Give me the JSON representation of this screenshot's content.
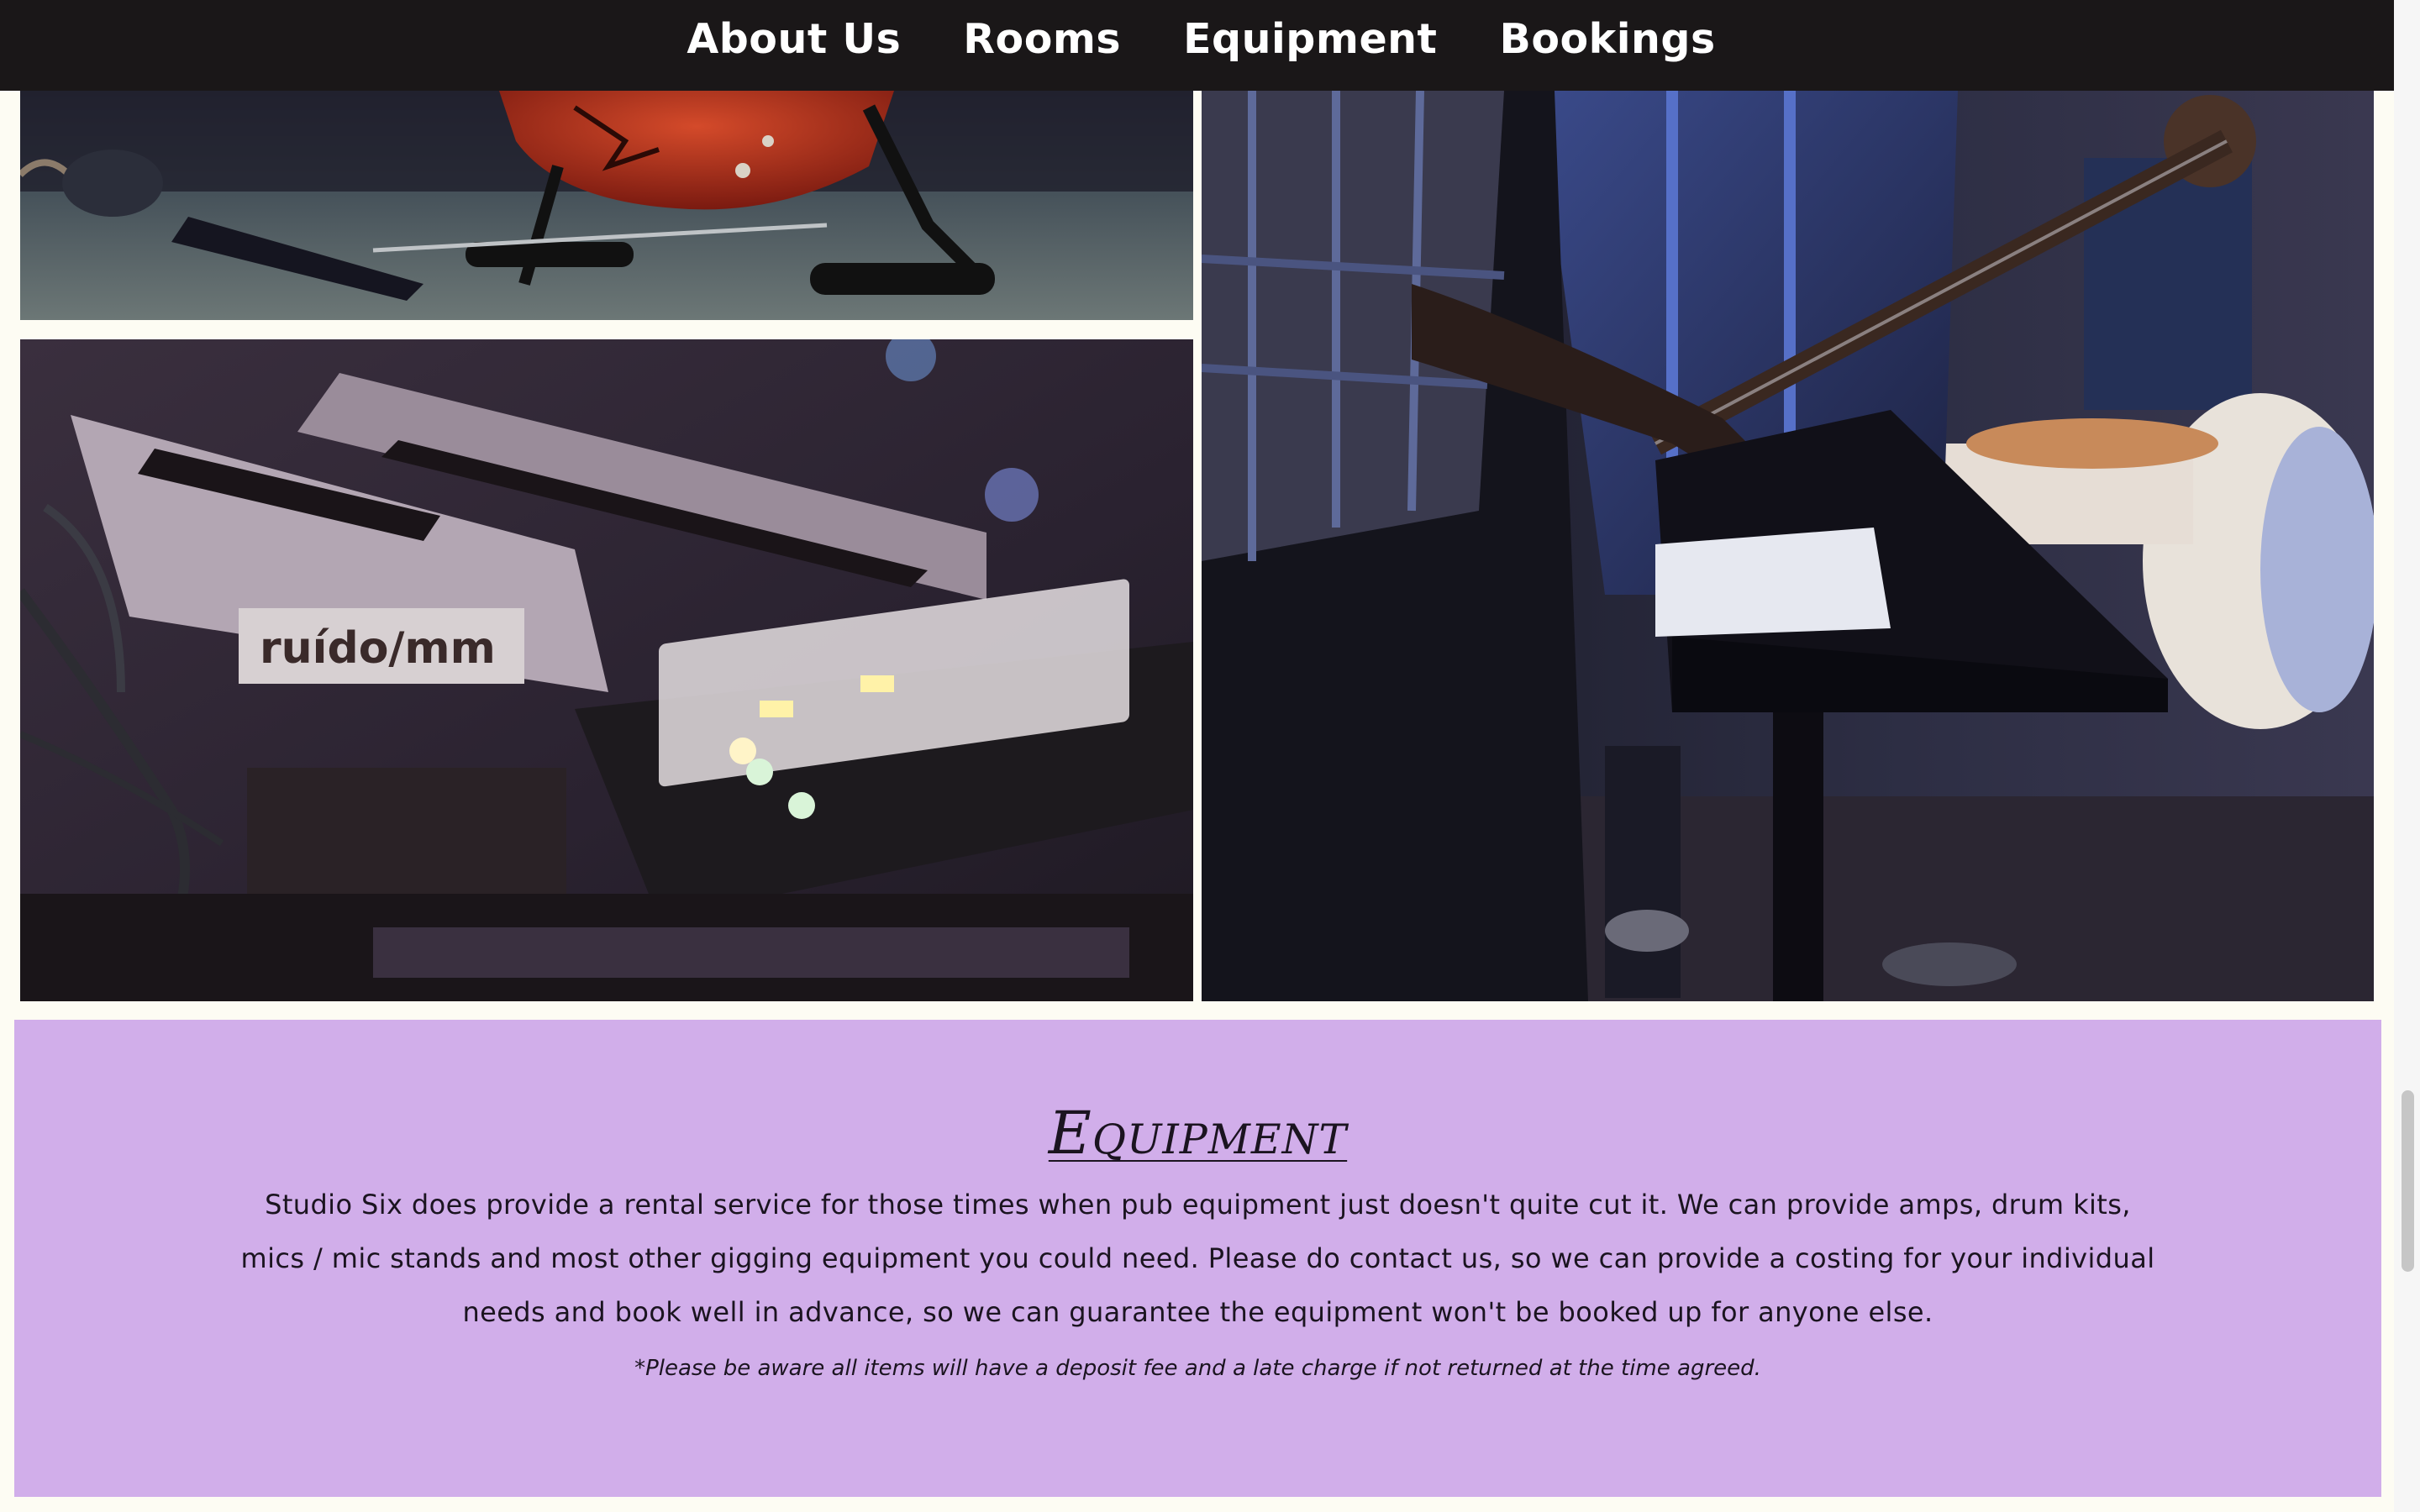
{
  "nav": {
    "items": [
      {
        "label": "About Us"
      },
      {
        "label": "Rooms"
      },
      {
        "label": "Equipment"
      },
      {
        "label": "Bookings"
      }
    ]
  },
  "photos": {
    "synths_brand": "ruído/mm"
  },
  "equipment": {
    "heading": "Equipment",
    "body": "Studio Six does provide a rental service for those times when pub equipment just doesn't quite cut it. We can provide amps, drum kits, mics / mic stands and most other gigging equipment you could need. Please do contact us, so we can provide a costing for your individual needs and book well in advance, so we can guarantee the equipment won't be booked up for anyone else.",
    "note": "*Please be aware all items will have a deposit fee and a late charge if not returned at the time agreed."
  },
  "colors": {
    "nav_background": "#1a1718",
    "section_background": "#d1aeea",
    "page_background": "#fdfcf3"
  }
}
